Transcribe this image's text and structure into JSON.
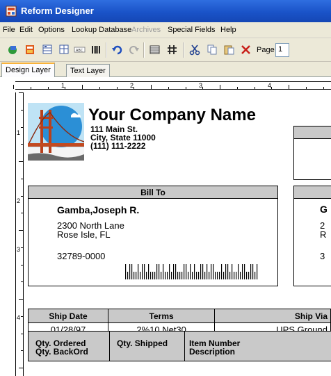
{
  "window": {
    "title": "Reform Designer",
    "app_icon": "reform-app-icon"
  },
  "menu": {
    "items": [
      {
        "label": "File",
        "enabled": true
      },
      {
        "label": "Edit",
        "enabled": true
      },
      {
        "label": "Options",
        "enabled": true
      },
      {
        "label": "Lookup Database",
        "enabled": true
      },
      {
        "label": "Archives",
        "enabled": false
      },
      {
        "label": "Special Fields",
        "enabled": true
      },
      {
        "label": "Help",
        "enabled": true
      }
    ]
  },
  "toolbar": {
    "icons": [
      "layer-icon",
      "form-icon",
      "grid-align-icon",
      "column-align-icon",
      "text-field-icon",
      "barcode-icon",
      "undo-icon",
      "redo-icon",
      "table-icon",
      "hash-icon",
      "cut-icon",
      "copy-icon",
      "paste-icon",
      "delete-icon"
    ],
    "page_label": "Page",
    "page_value": "1"
  },
  "tabs": [
    {
      "label": "Design Layer",
      "active": true
    },
    {
      "label": "Text Layer",
      "active": false
    }
  ],
  "rulers": {
    "horizontal": [
      "1",
      "2",
      "3",
      "4"
    ],
    "vertical": [
      "1",
      "2",
      "3",
      "4"
    ]
  },
  "form": {
    "company": {
      "name": "Your Company Name",
      "address1": "111 Main St.",
      "address2": "City, State 11000",
      "phone": "(111) 111-2222"
    },
    "bill_to": {
      "header": "Bill To",
      "name": "Gamba,Joseph R.",
      "street": "2300 North Lane",
      "city": "Rose Isle, FL",
      "zip": "32789-0000"
    },
    "ship_to_partial": {
      "name": "G",
      "street": "2",
      "city": "R",
      "zip": "3"
    },
    "shipping": {
      "headers": [
        "Ship Date",
        "Terms",
        "Ship Via"
      ],
      "values": [
        "01/28/97",
        "2%10 Net30",
        "UPS Ground"
      ]
    },
    "order_columns": [
      {
        "line1": "Qty. Ordered",
        "line2": "Qty. BackOrd"
      },
      {
        "line1": "Qty. Shipped",
        "line2": ""
      },
      {
        "line1": "Item Number",
        "line2": "Description"
      }
    ]
  },
  "colors": {
    "titlebar": "#1a53c8",
    "chrome": "#ece9d8",
    "header_fill": "#c9c9c9",
    "tab_accent": "#f9b33a"
  }
}
